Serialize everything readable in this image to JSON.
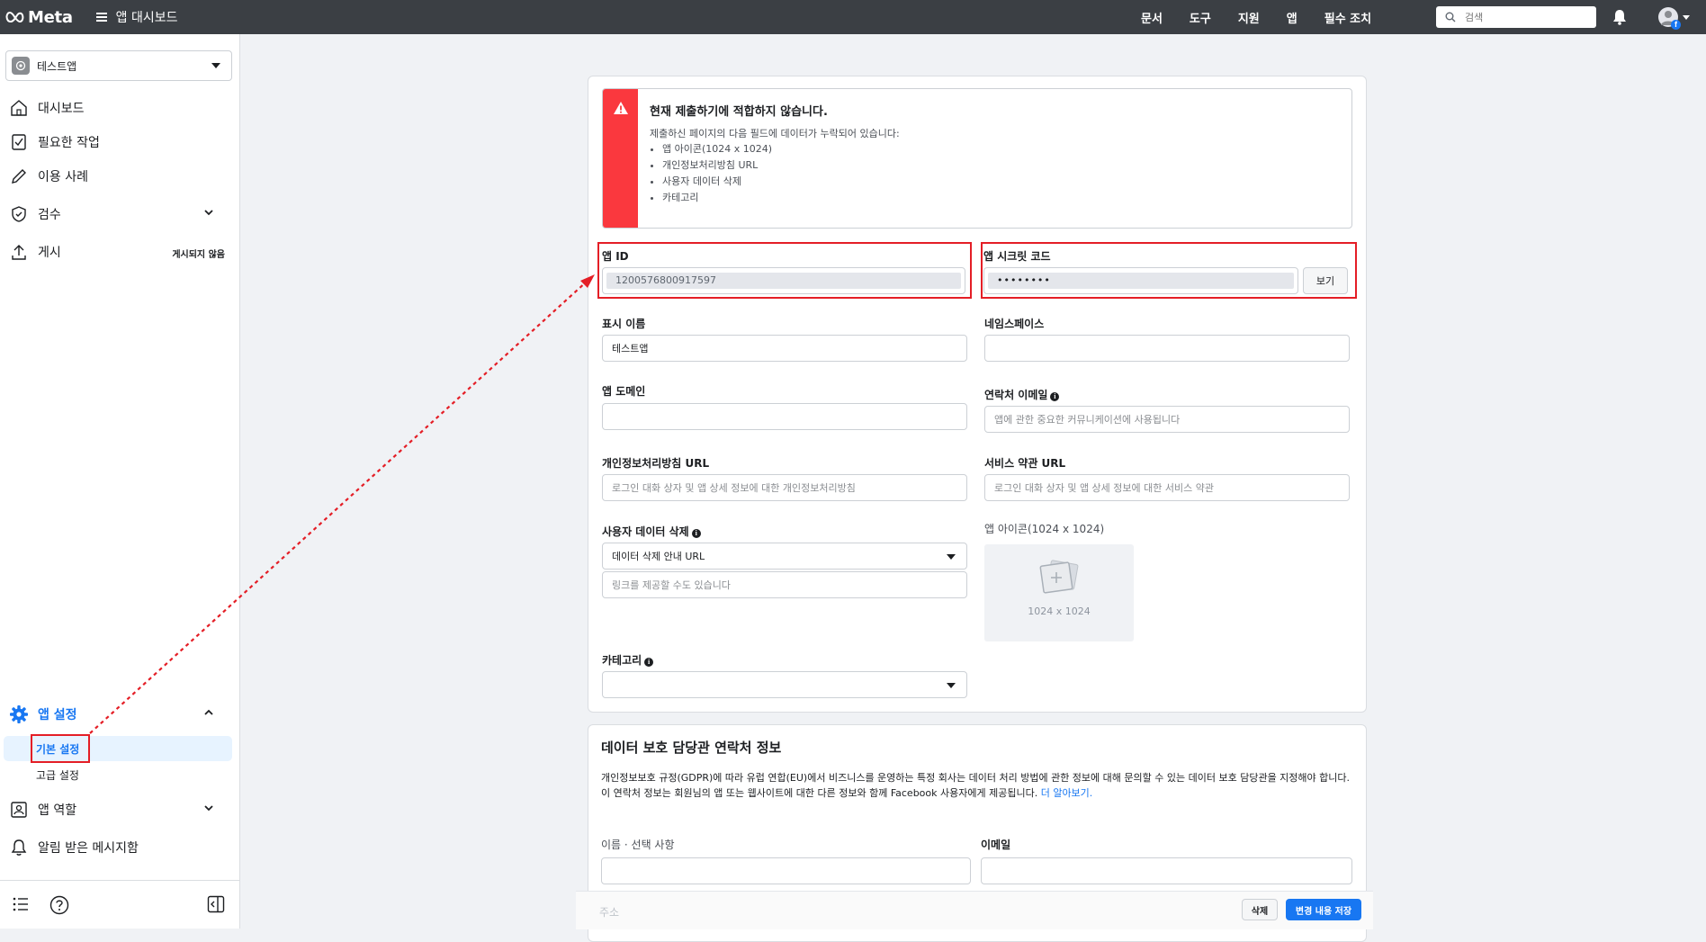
{
  "topbar": {
    "logo_text": "Meta",
    "app_title": "앱 대시보드",
    "nav": [
      "문서",
      "도구",
      "지원",
      "앱",
      "필수 조치"
    ],
    "search_placeholder": "검색"
  },
  "sidebar": {
    "app_name": "테스트앱",
    "items": {
      "dashboard": "대시보드",
      "required_actions": "필요한 작업",
      "use_cases": "이용 사례",
      "review": "검수",
      "publish": "게시",
      "publish_badge": "게시되지 않음",
      "app_settings": "앱 설정",
      "basic_settings": "기본 설정",
      "advanced_settings": "고급 설정",
      "app_roles": "앱 역할",
      "notifications": "알림 받은 메시지함"
    }
  },
  "alert": {
    "title": "현재 제출하기에 적합하지 않습니다.",
    "description": "제출하신 페이지의 다음 필드에 데이터가 누락되어 있습니다:",
    "missing": [
      "앱 아이콘(1024 x 1024)",
      "개인정보처리방침 URL",
      "사용자 데이터 삭제",
      "카테고리"
    ]
  },
  "form": {
    "app_id_label": "앱 ID",
    "app_id_value": "1200576800917597",
    "app_secret_label": "앱 시크릿 코드",
    "app_secret_value": "••••••••",
    "show_button": "보기",
    "display_name_label": "표시 이름",
    "display_name_value": "테스트앱",
    "namespace_label": "네임스페이스",
    "app_domain_label": "앱 도메인",
    "contact_email_label": "연락처 이메일",
    "contact_email_placeholder": "앱에 관한 중요한 커뮤니케이션에 사용됩니다",
    "privacy_url_label": "개인정보처리방침 URL",
    "privacy_url_placeholder": "로그인 대화 상자 및 앱 상세 정보에 대한 개인정보처리방침",
    "tos_url_label": "서비스 약관 URL",
    "tos_url_placeholder": "로그인 대화 상자 및 앱 상세 정보에 대한 서비스 약관",
    "user_data_deletion_label": "사용자 데이터 삭제",
    "user_data_deletion_select": "데이터 삭제 안내 URL",
    "user_data_deletion_placeholder": "링크를 제공할 수도 있습니다",
    "app_icon_label": "앱 아이콘(1024 x 1024)",
    "app_icon_size": "1024 x 1024",
    "category_label": "카테고리"
  },
  "dpo": {
    "heading": "데이터 보호 담당관 연락처 정보",
    "paragraph1": "개인정보보호 규정(GDPR)에 따라 유럽 연합(EU)에서 비즈니스를 운영하는 특정 회사는 데이터 처리 방법에 관한 정보에 대해 문의할 수 있는 데이터 보호 담당관을 지정해야 합니다.",
    "paragraph2": "이 연락처 정보는 회원님의 앱 또는 웹사이트에 대한 다른 정보와 함께 Facebook 사용자에게 제공됩니다.",
    "learn_more": "더 알아보기.",
    "name_label": "이름 · 선택 사항",
    "email_label": "이메일",
    "address_label": "주소"
  },
  "actions": {
    "delete": "삭제",
    "save": "변경 내용 저장"
  },
  "colors": {
    "accent": "#1877f2",
    "alert": "#fa383e",
    "highlight": "#e41e26"
  }
}
